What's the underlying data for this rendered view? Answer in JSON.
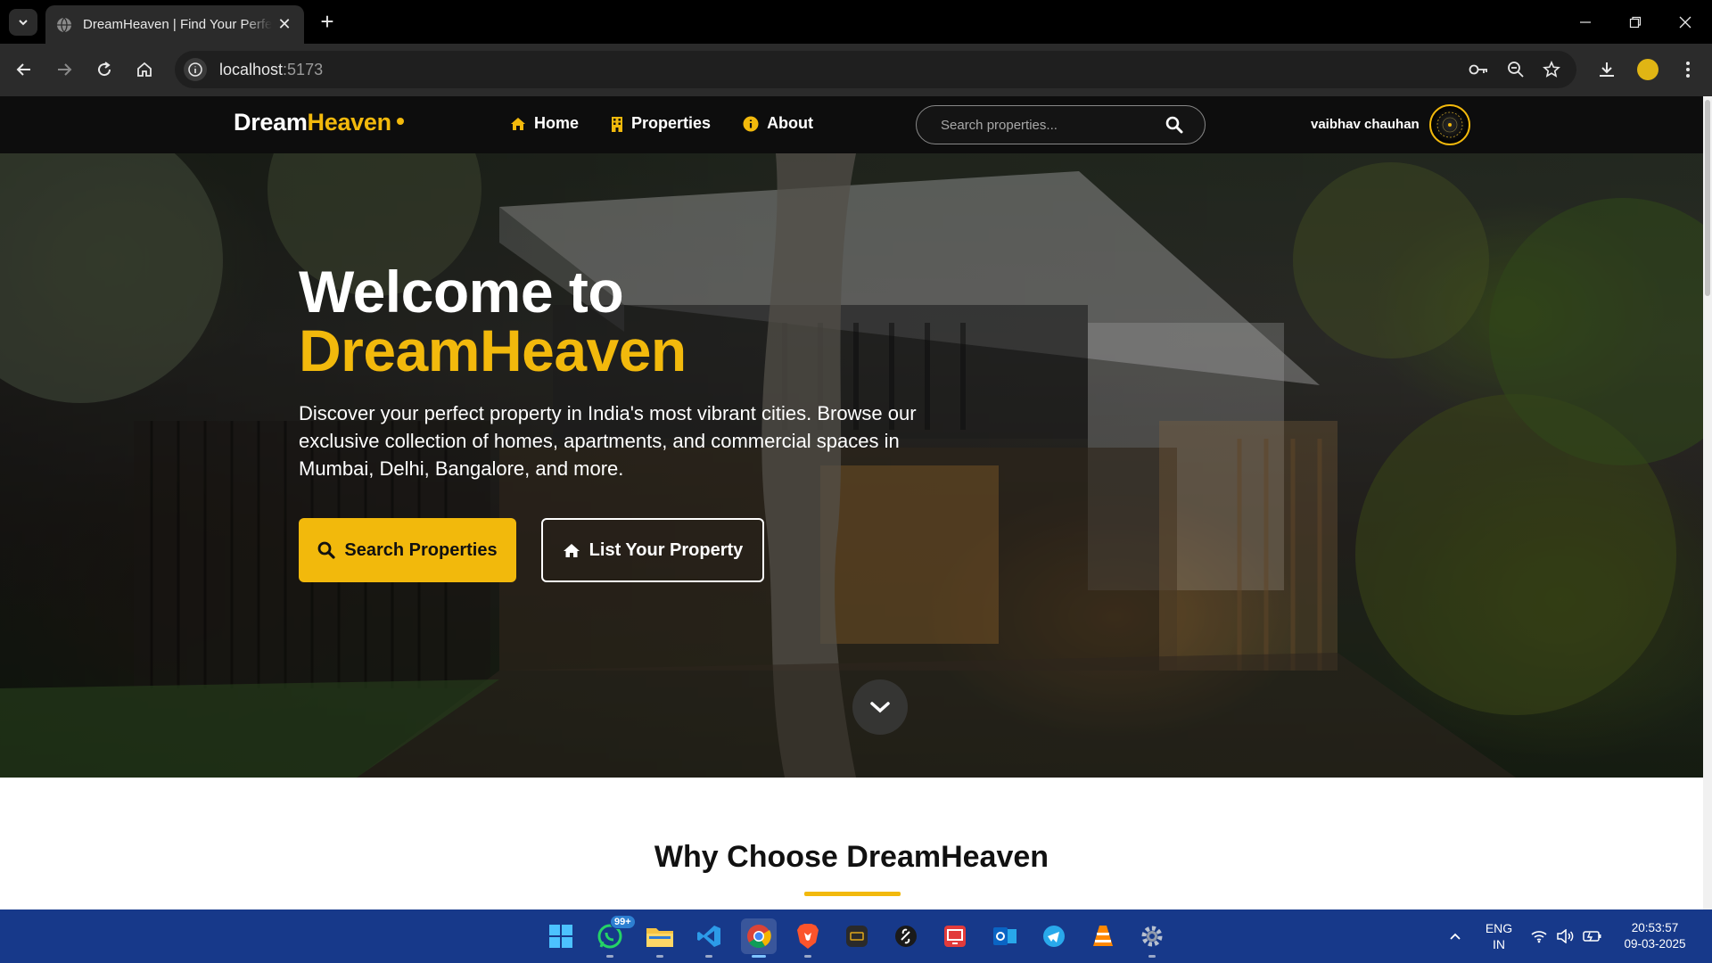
{
  "browser": {
    "tab_title": "DreamHeaven | Find Your Perfect Property",
    "url_host": "localhost",
    "url_port": ":5173",
    "new_tab_label": "+",
    "tab_close": "✕"
  },
  "site": {
    "logo_main": "Dream",
    "logo_accent": "Heaven",
    "nav": [
      {
        "label": "Home",
        "icon": "home-icon"
      },
      {
        "label": "Properties",
        "icon": "building-icon"
      },
      {
        "label": "About",
        "icon": "info-icon"
      }
    ],
    "search_placeholder": "Search properties...",
    "user_name": "vaibhav chauhan"
  },
  "hero": {
    "title_line1": "Welcome to",
    "title_line2": "DreamHeaven",
    "description": "Discover your perfect property in India's most vibrant cities. Browse our exclusive collection of homes, apartments, and commercial spaces in Mumbai, Delhi, Bangalore, and more.",
    "primary_button": "Search Properties",
    "secondary_button": "List Your Property"
  },
  "section": {
    "why_title": "Why Choose DreamHeaven"
  },
  "taskbar": {
    "whatsapp_badge": "99+",
    "language": "ENG",
    "region": "IN",
    "time": "20:53:57",
    "date": "09-03-2025"
  },
  "colors": {
    "accent": "#f2b90c",
    "nav_bg": "#0d0d0d",
    "taskbar_bg": "#17398a"
  }
}
